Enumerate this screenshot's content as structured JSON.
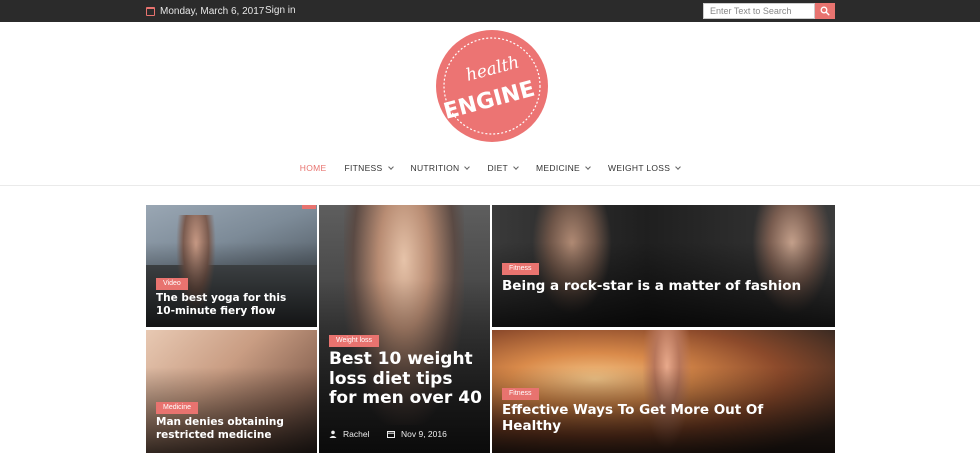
{
  "topbar": {
    "date": "Monday, March 6, 2017",
    "signin": "Sign in",
    "search_placeholder": "Enter Text to Search"
  },
  "logo": {
    "line1": "health",
    "line2": "ENGINE"
  },
  "nav": {
    "items": [
      {
        "label": "HOME"
      },
      {
        "label": "FITNESS"
      },
      {
        "label": "NUTRITION"
      },
      {
        "label": "DIET"
      },
      {
        "label": "MEDICINE"
      },
      {
        "label": "WEIGHT LOSS"
      }
    ]
  },
  "posts": [
    {
      "category": "Video",
      "title": "The best yoga for this 10-minute fiery flow"
    },
    {
      "category": "Weight loss",
      "title": "Best 10 weight loss diet tips for men over 40",
      "author": "Rachel",
      "date": "Nov 9, 2016"
    },
    {
      "category": "Fitness",
      "title": "Being a rock-star is a matter of fashion"
    },
    {
      "category": "Medicine",
      "title": "Man denies obtaining restricted medicine"
    },
    {
      "category": "Fitness",
      "title": "Effective Ways To Get More Out Of Healthy"
    }
  ],
  "colors": {
    "accent": "#e8736f",
    "topbar": "#2b2b2b"
  }
}
